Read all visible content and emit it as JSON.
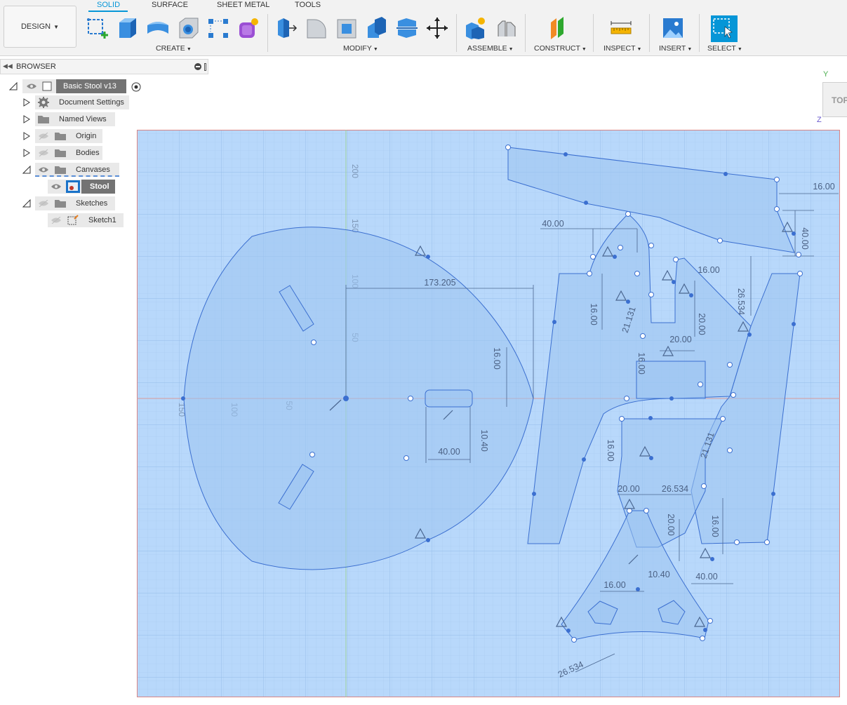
{
  "workspace": {
    "label": "DESIGN"
  },
  "tabs": [
    {
      "label": "SOLID",
      "active": true
    },
    {
      "label": "SURFACE"
    },
    {
      "label": "SHEET METAL"
    },
    {
      "label": "TOOLS"
    }
  ],
  "tool_groups": {
    "create": "CREATE",
    "modify": "MODIFY",
    "assemble": "ASSEMBLE",
    "construct": "CONSTRUCT",
    "inspect": "INSPECT",
    "insert": "INSERT",
    "select": "SELECT"
  },
  "icons": {
    "create": [
      "create-sketch-icon",
      "extrude-icon",
      "revolve-icon",
      "hole-icon",
      "pattern-icon",
      "create-form-icon"
    ],
    "modify": [
      "press-pull-icon",
      "fillet-icon",
      "shell-icon",
      "combine-icon",
      "split-icon",
      "move-icon"
    ],
    "assemble": [
      "new-component-icon",
      "joint-icon"
    ],
    "construct": [
      "offset-plane-icon"
    ],
    "inspect": [
      "measure-icon"
    ],
    "insert": [
      "insert-image-icon"
    ],
    "select": [
      "select-window-icon"
    ]
  },
  "browser": {
    "title": "BROWSER",
    "root": "Basic Stool v13",
    "items": [
      {
        "label": "Document Settings"
      },
      {
        "label": "Named Views"
      },
      {
        "label": "Origin"
      },
      {
        "label": "Bodies"
      },
      {
        "label": "Canvases"
      },
      {
        "label": "Stool"
      },
      {
        "label": "Sketches"
      },
      {
        "label": "Sketch1"
      }
    ]
  },
  "viewcube": {
    "face": "TOP",
    "axis_y": "Y",
    "axis_z": "Z"
  },
  "colors": {
    "canvas": "#b8d8fb",
    "sketch_line": "#3b6fd0",
    "accent": "#0696d7"
  },
  "rulers": {
    "vertical": [
      "200",
      "150",
      "100",
      "50"
    ],
    "horizontal": [
      "150",
      "100",
      "50"
    ]
  },
  "dimensions": [
    "173.205",
    "16.00",
    "10.40",
    "40.00",
    "40.00",
    "16.00",
    "16.00",
    "40.00",
    "21.131",
    "16.00",
    "26.534",
    "20.00",
    "20.00",
    "16.00",
    "16.00",
    "21.131",
    "20.00",
    "26.534",
    "20.00",
    "16.00",
    "16.00",
    "10.40",
    "40.00",
    "26.534"
  ]
}
